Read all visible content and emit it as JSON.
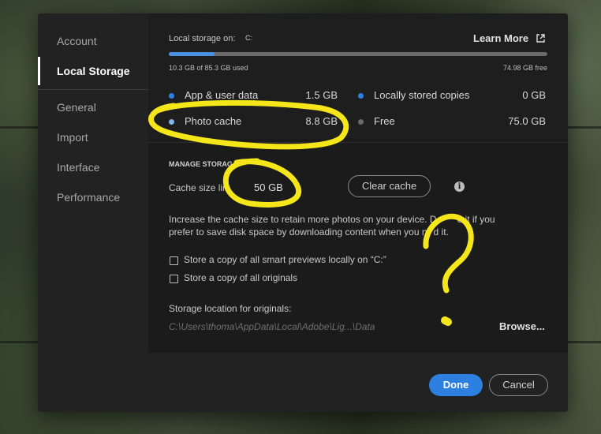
{
  "sidebar": {
    "items": [
      {
        "label": "Account",
        "active": false
      },
      {
        "label": "Local Storage",
        "active": true
      },
      {
        "label": "General",
        "active": false
      },
      {
        "label": "Import",
        "active": false
      },
      {
        "label": "Interface",
        "active": false
      },
      {
        "label": "Performance",
        "active": false
      }
    ]
  },
  "storage": {
    "location_label": "Local storage on:",
    "drive": "C:",
    "learn_more": "Learn More",
    "used_text": "10.3 GB of 85.3 GB used",
    "free_text": "74.98 GB free",
    "used_fraction": 0.12,
    "legend": [
      {
        "label": "App & user data",
        "value": "1.5 GB",
        "color": "#2d7fe0"
      },
      {
        "label": "Photo cache",
        "value": "8.8 GB",
        "color": "#7fb5ea"
      },
      {
        "label": "Locally stored copies",
        "value": "0 GB",
        "color": "#2d7fe0"
      },
      {
        "label": "Free",
        "value": "75.0 GB",
        "color": "#6a6a6a"
      }
    ]
  },
  "manage": {
    "heading": "MANAGE STORAG",
    "cache_label": "Cache size lim",
    "cache_value": "50 GB",
    "clear_cache": "Clear cache",
    "help_line1": "Increase the cache size to retain more photos on your device. D",
    "help_line1_end": "e it if you",
    "help_line2": "prefer to save disk space by downloading content when you n",
    "help_line2_end": "d it.",
    "checkbox_previews": "Store a copy of all smart previews locally on “C:”",
    "checkbox_originals": "Store a copy of all originals",
    "originals_location_label": "Storage location for originals:",
    "originals_path": "C:\\Users\\thoma\\AppData\\Local\\Adobe\\Lig...\\Data",
    "browse": "Browse..."
  },
  "footer": {
    "done": "Done",
    "cancel": "Cancel"
  },
  "colors": {
    "accent": "#2d7fe0",
    "annotation": "#f5e61a"
  },
  "icons": {
    "external_link": "external-link-icon",
    "info": "info-icon"
  }
}
